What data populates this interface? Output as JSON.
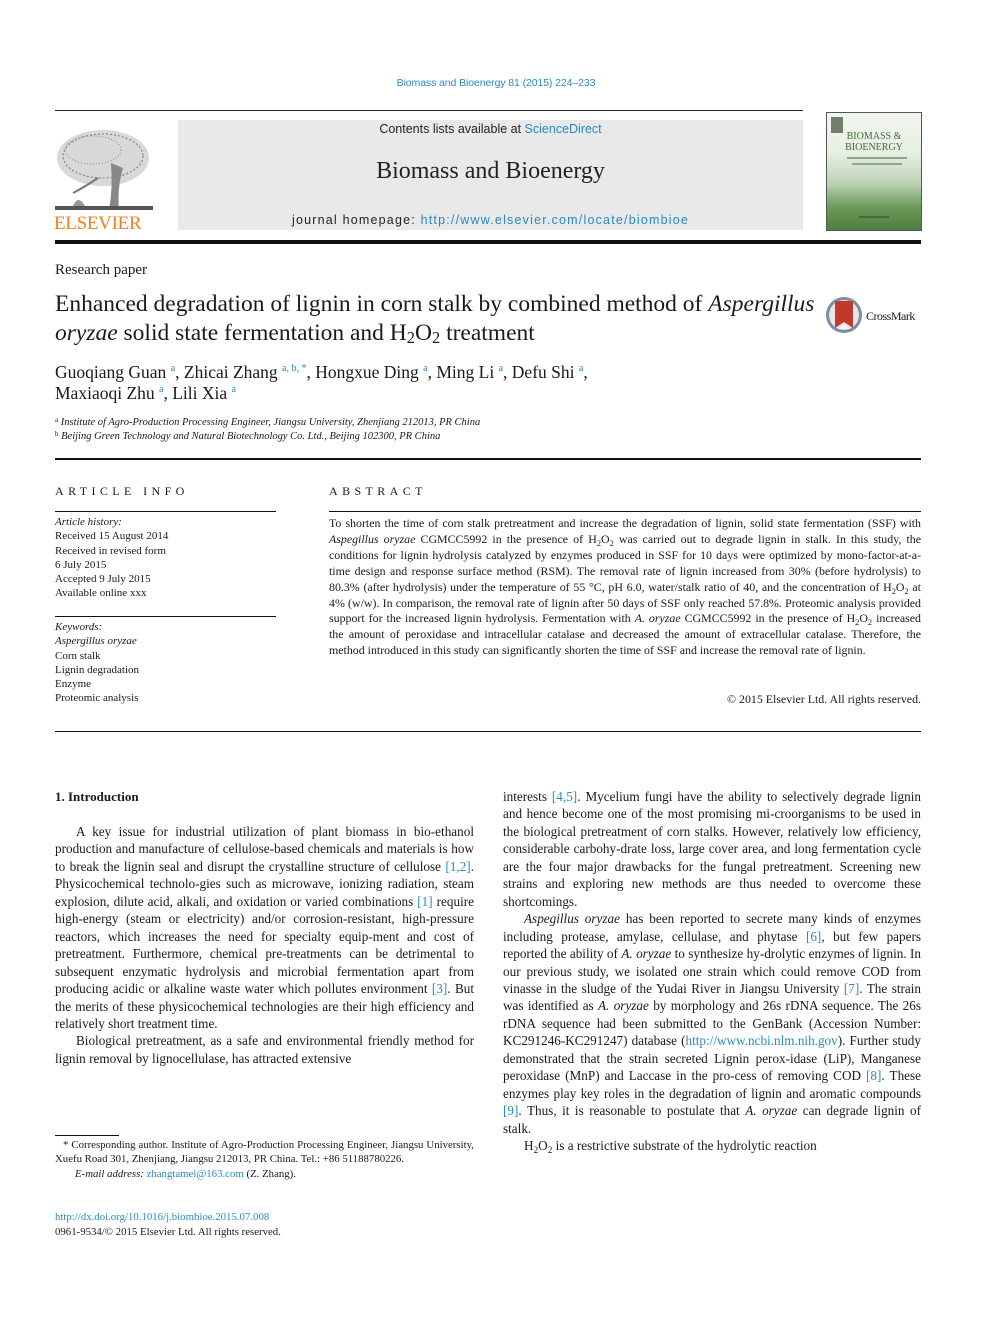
{
  "running_head": "Biomass and Bioenergy 81 (2015) 224–233",
  "header": {
    "publisher": "ELSEVIER",
    "contents_prefix": "Contents lists available at ",
    "contents_link": "ScienceDirect",
    "journal_title": "Biomass and Bioenergy",
    "homepage_prefix": "journal homepage: ",
    "homepage_link": "http://www.elsevier.com/locate/biombioe",
    "cover_title_line1": "BIOMASS &",
    "cover_title_line2": "BIOENERGY",
    "crossmark_label": "CrossMark"
  },
  "article": {
    "type": "Research paper",
    "title_part1": "Enhanced degradation of lignin in corn stalk by combined method of ",
    "title_italic": "Aspergillus oryzae",
    "title_part2": " solid state fermentation and H",
    "title_sub1": "2",
    "title_part3": "O",
    "title_sub2": "2",
    "title_part4": " treatment",
    "authors": [
      {
        "name": "Guoqiang Guan",
        "sup": "a",
        "sep": ", "
      },
      {
        "name": "Zhicai Zhang",
        "sup": "a, b, *",
        "sep": ", "
      },
      {
        "name": "Hongxue Ding",
        "sup": "a",
        "sep": ", "
      },
      {
        "name": "Ming Li",
        "sup": "a",
        "sep": ", "
      },
      {
        "name": "Defu Shi",
        "sup": "a",
        "sep": ","
      },
      {
        "name": "Maxiaoqi Zhu",
        "sup": "a",
        "sep": ", "
      },
      {
        "name": "Lili Xia",
        "sup": "a",
        "sep": ""
      }
    ],
    "affiliations": [
      {
        "mark": "a",
        "text": "Institute of Agro-Production Processing Engineer, Jiangsu University, Zhenjiang 212013, PR China"
      },
      {
        "mark": "b",
        "text": "Beijing Green Technology and Natural Biotechnology Co. Ltd., Beijing 102300, PR China"
      }
    ]
  },
  "article_info": {
    "heading": "ARTICLE INFO",
    "history_label": "Article history:",
    "history": [
      "Received 15 August 2014",
      "Received in revised form",
      "6 July 2015",
      "Accepted 9 July 2015",
      "Available online xxx"
    ],
    "keywords_label": "Keywords:",
    "keywords": [
      "Aspergillus oryzae",
      "Corn stalk",
      "Lignin degradation",
      "Enzyme",
      "Proteomic analysis"
    ]
  },
  "abstract": {
    "heading": "ABSTRACT",
    "s1": "To shorten the time of corn stalk pretreatment and increase the degradation of lignin, solid state fermentation (SSF) with ",
    "s1_italic": "Aspegillus oryzae",
    "s2": " CGMCC5992 in the presence of H",
    "s3": "O",
    "s4": " was carried out to degrade lignin in stalk. In this study, the conditions for lignin hydrolysis catalyzed by enzymes produced in SSF for 10 days were optimized by mono-factor-at-a-time design and response surface method (RSM). The removal rate of lignin increased from 30% (before hydrolysis) to 80.3% (after hydrolysis) under the temperature of 55 °C, pH 6.0, water/stalk ratio of 40, and the concentration of H",
    "s5": "O",
    "s6": " at 4% (w/w). In comparison, the removal rate of lignin after 50 days of SSF only reached 57.8%. Proteomic analysis provided support for the increased lignin hydrolysis. Fermentation with ",
    "s6_italic": "A. oryzae",
    "s7": " CGMCC5992 in the presence of H",
    "s8": "O",
    "s9": " increased the amount of peroxidase and intracellular catalase and decreased the amount of extracellular catalase. Therefore, the method introduced in this study can significantly shorten the time of SSF and increase the removal rate of lignin.",
    "sub": "2",
    "copyright": "© 2015 Elsevier Ltd. All rights reserved."
  },
  "body": {
    "section_heading": "1.  Introduction",
    "left_p1_a": "A key issue for industrial utilization of plant biomass in bio-ethanol production and manufacture of cellulose-based chemicals and materials is how to break the lignin seal and disrupt the crystalline structure of cellulose ",
    "left_p1_ref1": "[1,2]",
    "left_p1_b": ". Physicochemical technolo-gies such as microwave, ionizing radiation, steam explosion, dilute acid, alkali, and oxidation or varied combinations ",
    "left_p1_ref2": "[1]",
    "left_p1_c": " require high-energy (steam or electricity) and/or corrosion-resistant, high-pressure reactors, which increases the need for specialty equip-ment and cost of pretreatment. Furthermore, chemical pre-treatments can be detrimental to subsequent enzymatic hydrolysis and microbial fermentation apart from producing acidic or alkaline waste water which pollutes environment ",
    "left_p1_ref3": "[3]",
    "left_p1_d": ". But the merits of these physicochemical technologies are their high efficiency and relatively short treatment time.",
    "left_p2": "Biological pretreatment, as a safe and environmental friendly method for lignin removal by lignocellulase, has attracted extensive",
    "right_p1_a": "interests ",
    "right_p1_ref": "[4,5]",
    "right_p1_b": ". Mycelium fungi have the ability to selectively degrade lignin and hence become one of the most promising mi-croorganisms to be used in the biological pretreatment of corn stalks. However, relatively low efficiency, considerable carbohy-drate loss, large cover area, and long fermentation cycle are the four major drawbacks for the fungal pretreatment. Screening new strains and exploring new methods are thus needed to overcome these shortcomings.",
    "right_p2_it": "Aspegillus oryzae",
    "right_p2_a": " has been reported to secrete many kinds of enzymes including protease, amylase, cellulase, and phytase ",
    "right_p2_ref1": "[6]",
    "right_p2_b": ", but few papers reported the ability of ",
    "right_p2_it2": "A. oryzae",
    "right_p2_c": " to synthesize hy-drolytic enzymes of lignin. In our previous study, we isolated one strain which could remove COD from vinasse in the sludge of the Yudai River in Jiangsu University ",
    "right_p2_ref2": "[7]",
    "right_p2_d": ". The strain was identified as ",
    "right_p2_it3": "A. oryzae",
    "right_p2_e": " by morphology and 26s rDNA sequence. The 26s rDNA sequence had been submitted to the GenBank (Accession Number: KC291246-KC291247) database (",
    "right_p2_link": "http://www.ncbi.nlm.nih.gov",
    "right_p2_f": "). Further study demonstrated that the strain secreted Lignin perox-idase (LiP), Manganese peroxidase (MnP) and Laccase in the pro-cess of removing COD ",
    "right_p2_ref3": "[8]",
    "right_p2_g": ". These enzymes play key roles in the degradation of lignin and aromatic compounds ",
    "right_p2_ref4": "[9]",
    "right_p2_h": ". Thus, it is reasonable to postulate that ",
    "right_p2_it4": "A. oryzae",
    "right_p2_i": " can degrade lignin of stalk.",
    "right_p3_a": "H",
    "right_p3_b": "O",
    "right_p3_c": " is a restrictive substrate of the hydrolytic reaction"
  },
  "footnotes": {
    "corresponding": "* Corresponding author. Institute of Agro-Production Processing Engineer, Jiangsu University, Xuefu Road 301, Zhenjiang, Jiangsu 212013, PR China. Tel.: +86 51188780226.",
    "email_label": "E-mail address: ",
    "email": "zhangtamei@163.com",
    "email_suffix": " (Z. Zhang).",
    "doi": "http://dx.doi.org/10.1016/j.biombioe.2015.07.008",
    "issn": "0961-9534/© 2015 Elsevier Ltd. All rights reserved."
  },
  "colors": {
    "link": "#2a8ac0",
    "elsevier_orange": "#f07f1f",
    "header_box": "#e9e9e9",
    "crossmark_red": "#c0392b"
  }
}
